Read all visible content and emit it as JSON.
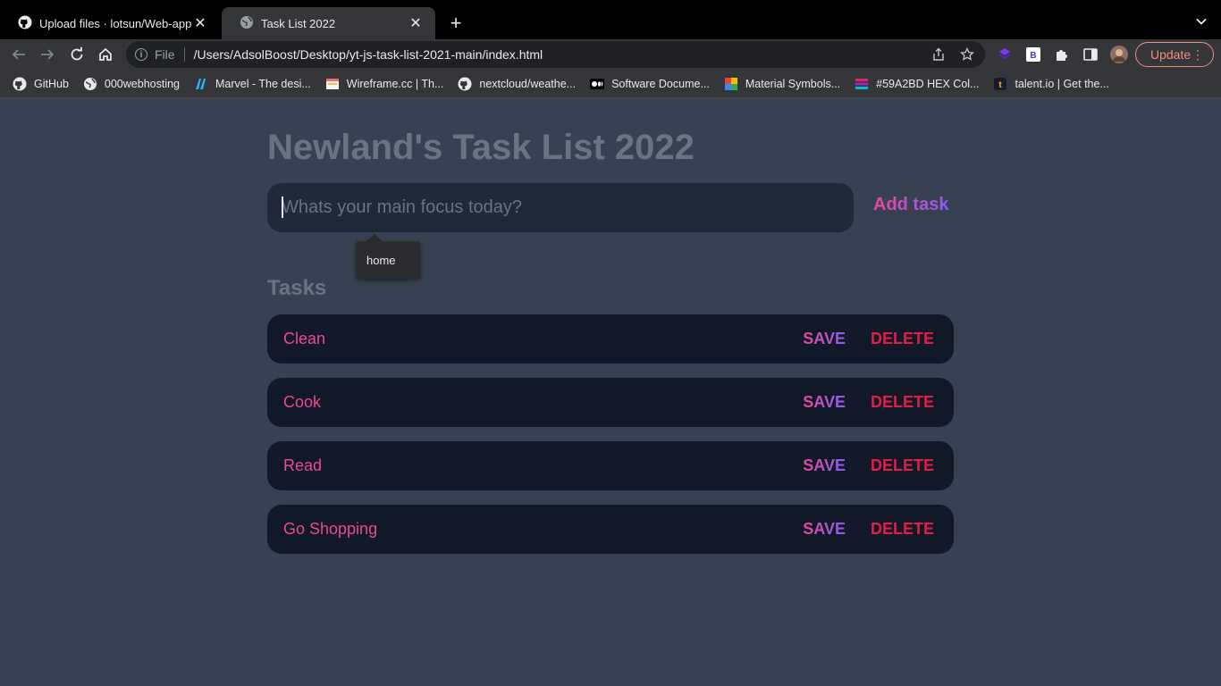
{
  "browser": {
    "tabs": [
      {
        "title": "Upload files · lotsun/Web-app-",
        "icon": "github-icon"
      },
      {
        "title": "Task List 2022",
        "icon": "globe-icon"
      }
    ],
    "address": {
      "scheme": "File",
      "url": "/Users/AdsolBoost/Desktop/yt-js-task-list-2021-main/index.html"
    },
    "update_label": "Update",
    "bookmarks": [
      {
        "label": "GitHub",
        "icon": "github-icon"
      },
      {
        "label": "000webhosting",
        "icon": "globe-icon"
      },
      {
        "label": "Marvel - The desi...",
        "icon": "marvel-icon"
      },
      {
        "label": "Wireframe.cc | Th...",
        "icon": "wireframe-icon"
      },
      {
        "label": "nextcloud/weathe...",
        "icon": "github-icon"
      },
      {
        "label": "Software Docume...",
        "icon": "medium-icon"
      },
      {
        "label": "Material Symbols...",
        "icon": "google-icon"
      },
      {
        "label": "#59A2BD HEX Col...",
        "icon": "color-icon"
      },
      {
        "label": "talent.io | Get the...",
        "icon": "talent-icon"
      }
    ]
  },
  "app": {
    "title": "Newland's Task List 2022",
    "input_placeholder": "Whats your main focus today?",
    "add_label": "Add task",
    "autocomplete": "home",
    "section_title": "Tasks",
    "save_label": "SAVE",
    "delete_label": "DELETE",
    "tasks": [
      "Clean",
      "Cook",
      "Read",
      "Go Shopping"
    ]
  },
  "colors": {
    "page_bg": "#374151",
    "input_bg": "#1f2937",
    "task_bg": "#111827",
    "pink": "#ec4899",
    "purple": "#8b5cf6",
    "delete_red": "#e11d48",
    "muted_text": "#6b7280"
  }
}
